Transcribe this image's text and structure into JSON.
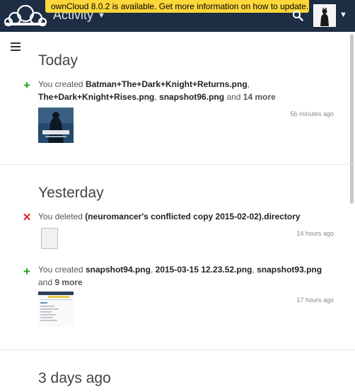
{
  "header": {
    "app_title": "Activity",
    "update_banner": "ownCloud 8.0.2 is available. Get more information on how to update."
  },
  "sections": [
    {
      "title": "Today",
      "events": [
        {
          "type": "created",
          "prefix": "You created ",
          "files": [
            "Batman+The+Dark+Knight+Returns.png",
            "The+Dark+Knight+Rises.png",
            "snapshot96.png"
          ],
          "and": " and ",
          "more": "14 more",
          "time": "56 minutes ago"
        }
      ]
    },
    {
      "title": "Yesterday",
      "events": [
        {
          "type": "deleted",
          "prefix": "You deleted ",
          "files": [
            "(neuromancer's conflicted copy 2015-02-02).directory"
          ],
          "time": "14 hours ago"
        },
        {
          "type": "created",
          "prefix": "You created ",
          "files": [
            "snapshot94.png",
            "2015-03-15 12.23.52.png",
            "snapshot93.png"
          ],
          "and": "and ",
          "more": "9 more",
          "time": "17 hours ago"
        }
      ]
    },
    {
      "title": "3 days ago"
    }
  ],
  "icons": {
    "logo": "owncloud-logo",
    "search": "search-icon",
    "menu": "hamburger-icon",
    "add": "plus-icon",
    "delete": "cross-icon"
  },
  "colors": {
    "header_bg": "#1d2d44",
    "banner_bg": "#fed73a",
    "add_green": "#1ea01e",
    "delete_red": "#dd2222"
  }
}
